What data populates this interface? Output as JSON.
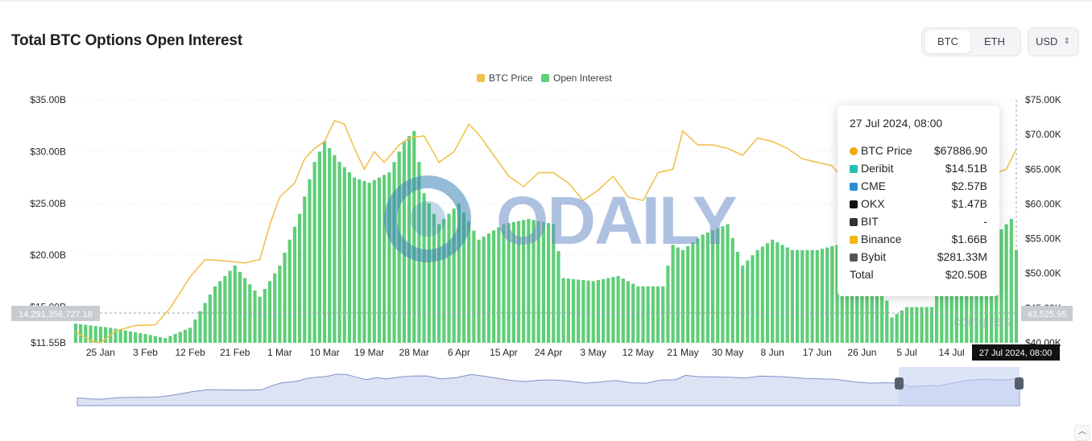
{
  "page": {
    "title": "Total BTC Options Open Interest",
    "toggle": {
      "options": [
        "BTC",
        "ETH"
      ],
      "active": "BTC"
    },
    "currency": {
      "selected": "USD",
      "caret": "⇕"
    }
  },
  "legend": [
    {
      "label": "BTC Price",
      "color": "#f2c14e"
    },
    {
      "label": "Open Interest",
      "color": "#5fce78"
    }
  ],
  "axes": {
    "left_ticks": [
      "$35.00B",
      "$30.00B",
      "$25.00B",
      "$20.00B",
      "$15.00B",
      "$11.55B"
    ],
    "right_ticks": [
      "$75.00K",
      "$70.00K",
      "$65.00K",
      "$60.00K",
      "$55.00K",
      "$50.00K",
      "$45.00K",
      "$40.00K"
    ],
    "x_ticks": [
      "25 Jan",
      "3 Feb",
      "12 Feb",
      "21 Feb",
      "1 Mar",
      "10 Mar",
      "19 Mar",
      "28 Mar",
      "6 Apr",
      "15 Apr",
      "24 Apr",
      "3 May",
      "12 May",
      "21 May",
      "30 May",
      "8 Jun",
      "17 Jun",
      "26 Jun",
      "5 Jul",
      "14 Jul"
    ],
    "crosshair_left": "14,291,356,727.18",
    "crosshair_right": "43,525.95",
    "crosshair_x": "27 Jul 2024, 08:00"
  },
  "watermark": {
    "text": "ODAILY",
    "logo_text": "coinglass"
  },
  "tooltip": {
    "date": "27 Jul 2024, 08:00",
    "rows": [
      {
        "icon": "btc-price-dot-icon",
        "label": "BTC Price",
        "value": "$67886.90",
        "color": "#f2a900"
      },
      {
        "icon": "deribit-icon",
        "label": "Deribit",
        "value": "$14.51B",
        "color": "#26c0b0"
      },
      {
        "icon": "cme-icon",
        "label": "CME",
        "value": "$2.57B",
        "color": "#2a8fd8"
      },
      {
        "icon": "okx-icon",
        "label": "OKX",
        "value": "$1.47B",
        "color": "#111111"
      },
      {
        "icon": "bit-icon",
        "label": "BIT",
        "value": "-",
        "color": "#333333"
      },
      {
        "icon": "binance-icon",
        "label": "Binance",
        "value": "$1.66B",
        "color": "#f0b90b"
      },
      {
        "icon": "bybit-icon",
        "label": "Bybit",
        "value": "$281.33M",
        "color": "#555555"
      }
    ],
    "total_label": "Total",
    "total_value": "$20.50B"
  },
  "chart_data": {
    "type": "bar",
    "title": "Total BTC Options Open Interest",
    "x_range": [
      "2024-01-20",
      "2024-07-27"
    ],
    "y_left_range": [
      11.55,
      35.0
    ],
    "y_left_unit": "$B",
    "y_right_range": [
      40.0,
      75.0
    ],
    "y_right_unit": "$K",
    "grid": true,
    "legend_position": "top-center",
    "series": [
      {
        "name": "Open Interest",
        "kind": "bar",
        "axis": "left",
        "x": [
          "2024-01-20",
          "2024-01-27",
          "2024-02-03",
          "2024-02-07",
          "2024-02-12",
          "2024-02-17",
          "2024-02-21",
          "2024-02-26",
          "2024-03-01",
          "2024-03-05",
          "2024-03-08",
          "2024-03-10",
          "2024-03-13",
          "2024-03-16",
          "2024-03-19",
          "2024-03-23",
          "2024-03-26",
          "2024-03-28",
          "2024-03-30",
          "2024-04-02",
          "2024-04-06",
          "2024-04-10",
          "2024-04-15",
          "2024-04-20",
          "2024-04-25",
          "2024-04-27",
          "2024-05-03",
          "2024-05-08",
          "2024-05-12",
          "2024-05-17",
          "2024-05-19",
          "2024-05-21",
          "2024-05-25",
          "2024-05-30",
          "2024-06-02",
          "2024-06-05",
          "2024-06-08",
          "2024-06-12",
          "2024-06-17",
          "2024-06-21",
          "2024-06-25",
          "2024-06-28",
          "2024-07-02",
          "2024-07-05",
          "2024-07-10",
          "2024-07-14",
          "2024-07-19",
          "2024-07-23",
          "2024-07-26",
          "2024-07-27"
        ],
        "values": [
          13.4,
          13.0,
          12.4,
          12.0,
          13.0,
          17.0,
          19.0,
          16.0,
          19.0,
          24.0,
          29.0,
          31.0,
          29.0,
          27.5,
          27.0,
          28.0,
          31.0,
          32.0,
          26.0,
          23.0,
          25.0,
          21.5,
          23.0,
          23.5,
          23.0,
          17.8,
          17.5,
          18.0,
          17.0,
          17.0,
          21.0,
          20.5,
          22.0,
          23.0,
          19.0,
          20.5,
          21.5,
          20.5,
          20.5,
          21.0,
          21.5,
          20.5,
          14.0,
          15.0,
          15.0,
          21.0,
          21.0,
          22.0,
          23.5,
          20.5
        ]
      },
      {
        "name": "BTC Price",
        "kind": "line",
        "axis": "right",
        "x": [
          "2024-01-20",
          "2024-01-23",
          "2024-01-25",
          "2024-01-28",
          "2024-02-01",
          "2024-02-05",
          "2024-02-08",
          "2024-02-12",
          "2024-02-15",
          "2024-02-19",
          "2024-02-23",
          "2024-02-26",
          "2024-02-28",
          "2024-03-01",
          "2024-03-04",
          "2024-03-06",
          "2024-03-08",
          "2024-03-10",
          "2024-03-12",
          "2024-03-14",
          "2024-03-16",
          "2024-03-18",
          "2024-03-20",
          "2024-03-22",
          "2024-03-25",
          "2024-03-27",
          "2024-03-30",
          "2024-04-02",
          "2024-04-05",
          "2024-04-08",
          "2024-04-10",
          "2024-04-13",
          "2024-04-16",
          "2024-04-19",
          "2024-04-22",
          "2024-04-25",
          "2024-04-28",
          "2024-05-01",
          "2024-05-04",
          "2024-05-07",
          "2024-05-10",
          "2024-05-13",
          "2024-05-16",
          "2024-05-19",
          "2024-05-21",
          "2024-05-24",
          "2024-05-27",
          "2024-05-30",
          "2024-06-02",
          "2024-06-05",
          "2024-06-08",
          "2024-06-11",
          "2024-06-14",
          "2024-06-17",
          "2024-06-20",
          "2024-06-24",
          "2024-06-27",
          "2024-06-30",
          "2024-07-03",
          "2024-07-05",
          "2024-07-08",
          "2024-07-11",
          "2024-07-14",
          "2024-07-17",
          "2024-07-20",
          "2024-07-23",
          "2024-07-25",
          "2024-07-27"
        ],
        "values": [
          41.6,
          40.3,
          40.0,
          41.7,
          42.5,
          42.6,
          45.0,
          49.5,
          52.0,
          51.8,
          51.5,
          52.0,
          57.0,
          61.0,
          63.0,
          66.5,
          68.0,
          69.0,
          72.0,
          71.5,
          68.0,
          65.0,
          67.5,
          66.0,
          68.5,
          69.5,
          69.8,
          66.0,
          67.5,
          71.5,
          70.0,
          67.0,
          64.0,
          62.5,
          64.5,
          64.5,
          63.0,
          60.5,
          62.0,
          64.0,
          61.0,
          60.5,
          64.5,
          65.0,
          70.5,
          68.5,
          68.5,
          68.0,
          67.0,
          69.5,
          69.0,
          68.0,
          66.5,
          66.0,
          65.5,
          62.0,
          60.5,
          61.0,
          60.5,
          56.0,
          57.0,
          57.5,
          61.0,
          64.5,
          65.5,
          64.5,
          65.0,
          67.9
        ]
      }
    ]
  }
}
